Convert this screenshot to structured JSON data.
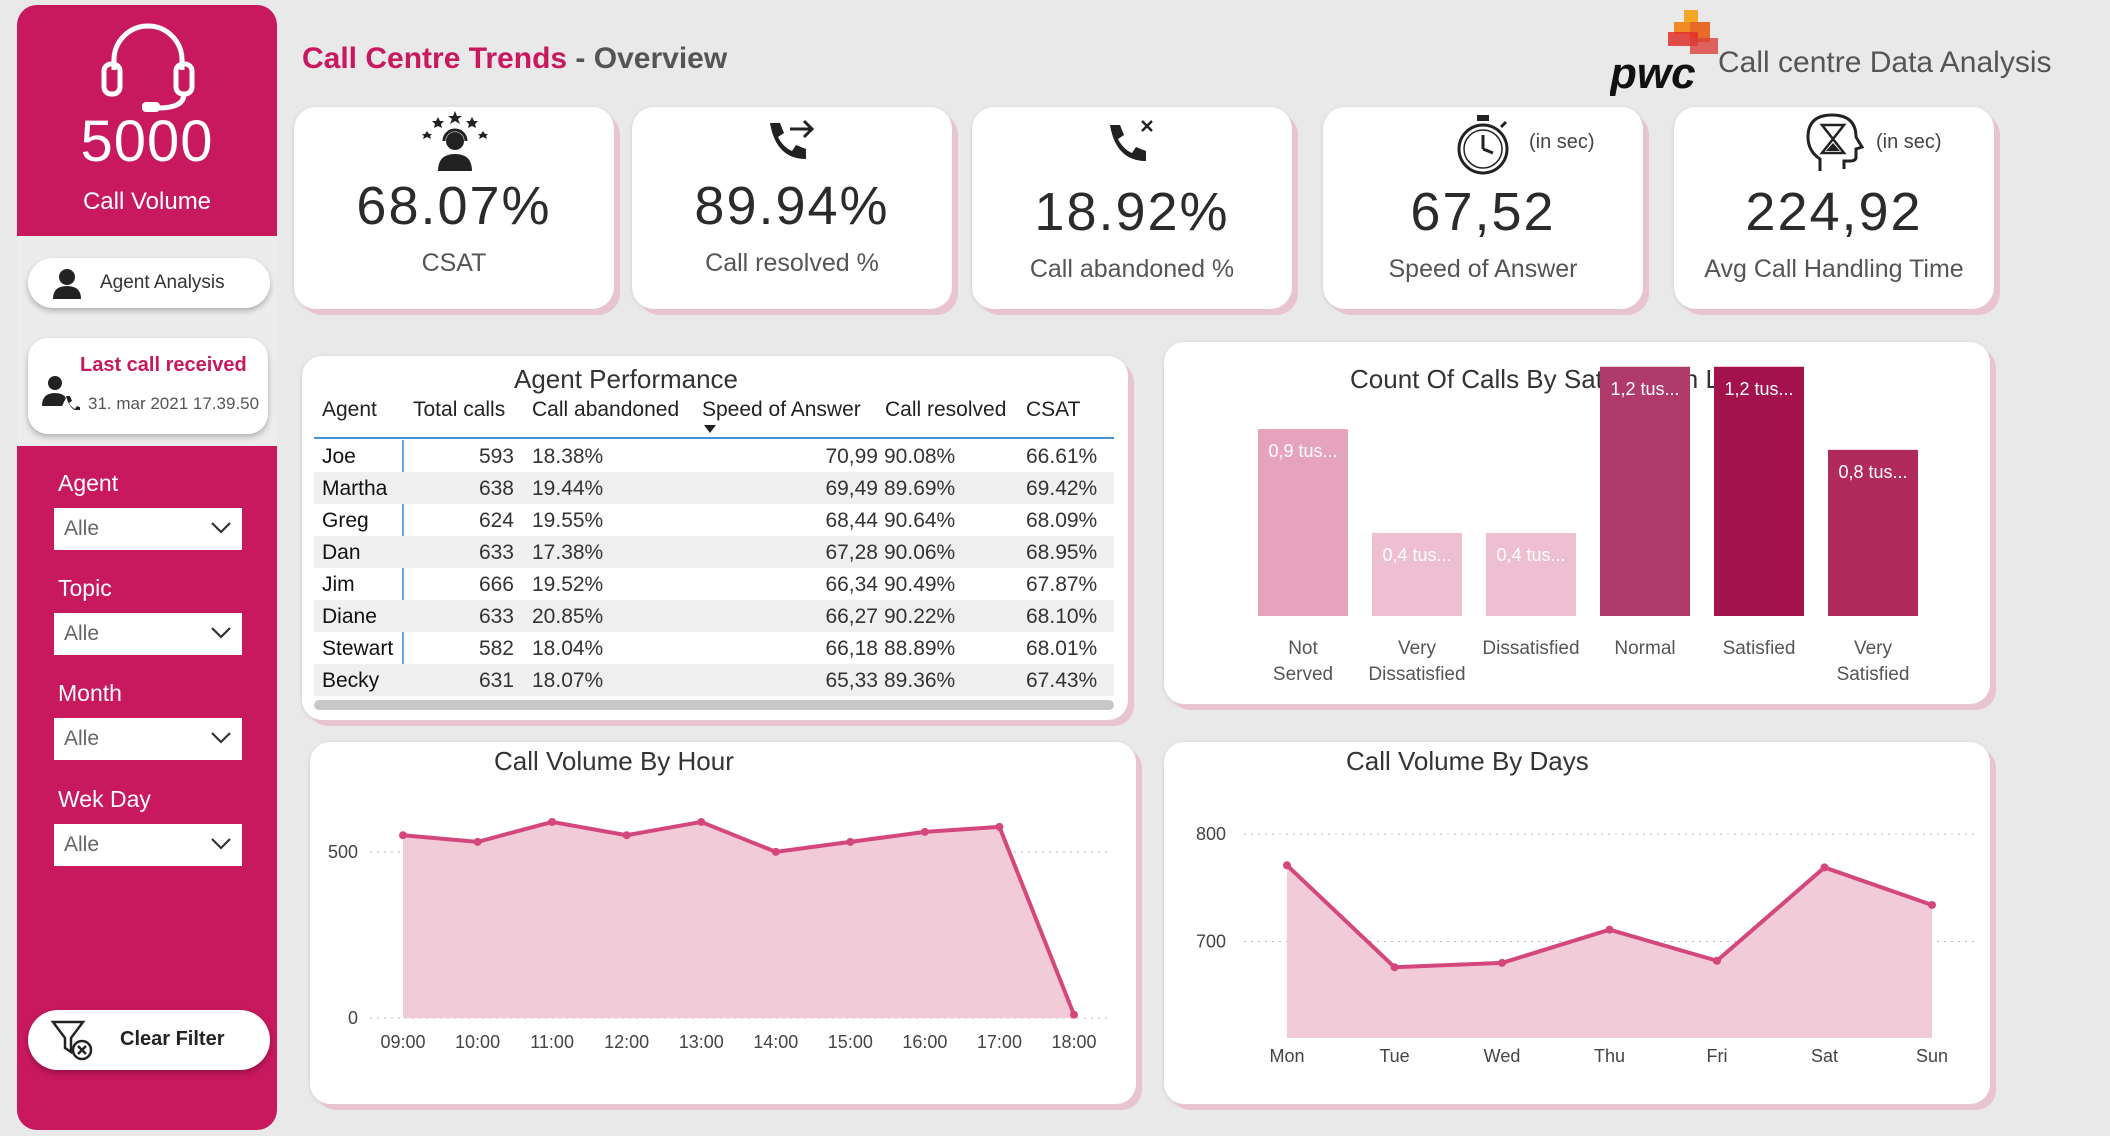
{
  "header": {
    "title_part1": "Call Centre Trends",
    "title_sep": " - ",
    "title_part2": "Overview",
    "brand": "pwc",
    "subtitle": "Call centre Data Analysis"
  },
  "sidebar": {
    "volume_value": "5000",
    "volume_label": "Call Volume",
    "agent_analysis_label": "Agent Analysis",
    "last_call_title": "Last call received",
    "last_call_value": "31. mar 2021 17.39.50",
    "filters": [
      {
        "label": "Agent",
        "value": "Alle"
      },
      {
        "label": "Topic",
        "value": "Alle"
      },
      {
        "label": "Month",
        "value": "Alle"
      },
      {
        "label": "Wek Day",
        "value": "Alle"
      }
    ],
    "clear_filter_label": "Clear Filter"
  },
  "kpis": [
    {
      "value": "68.07%",
      "label": "CSAT",
      "icon": "satisfaction-stars-icon"
    },
    {
      "value": "89.94%",
      "label": "Call resolved %",
      "icon": "phone-forward-icon"
    },
    {
      "value": "18.92%",
      "label": "Call abandoned %",
      "icon": "phone-missed-icon"
    },
    {
      "value": "67,52",
      "label": "Speed of Answer",
      "unit": "(in sec)",
      "icon": "stopwatch-icon"
    },
    {
      "value": "224,92",
      "label": "Avg Call Handling Time",
      "unit": "(in sec)",
      "icon": "head-hourglass-icon"
    }
  ],
  "agent_table": {
    "title": "Agent Performance",
    "columns": [
      "Agent",
      "Total calls",
      "Call abandoned",
      "Speed of Answer",
      "Call resolved",
      "CSAT"
    ],
    "rows": [
      [
        "Joe",
        "593",
        "18.38%",
        "70,99",
        "90.08%",
        "66.61%"
      ],
      [
        "Martha",
        "638",
        "19.44%",
        "69,49",
        "89.69%",
        "69.42%"
      ],
      [
        "Greg",
        "624",
        "19.55%",
        "68,44",
        "90.64%",
        "68.09%"
      ],
      [
        "Dan",
        "633",
        "17.38%",
        "67,28",
        "90.06%",
        "68.95%"
      ],
      [
        "Jim",
        "666",
        "19.52%",
        "66,34",
        "90.49%",
        "67.87%"
      ],
      [
        "Diane",
        "633",
        "20.85%",
        "66,27",
        "90.22%",
        "68.10%"
      ],
      [
        "Stewart",
        "582",
        "18.04%",
        "66,18",
        "88.89%",
        "68.01%"
      ],
      [
        "Becky",
        "631",
        "18.07%",
        "65,33",
        "89.36%",
        "67.43%"
      ]
    ]
  },
  "chart_data": [
    {
      "type": "bar",
      "title": "Count Of Calls By Satisfaction Level",
      "categories": [
        "Not Served",
        "Very Dissatisfied",
        "Dissatisfied",
        "Normal",
        "Satisfied",
        "Very Satisfied"
      ],
      "values": [
        900,
        400,
        400,
        1200,
        1200,
        800
      ],
      "data_labels": [
        "0,9 tus...",
        "0,4 tus...",
        "0,4 tus...",
        "1,2 tus...",
        "1,2 tus...",
        "0,8 tus..."
      ],
      "colors": [
        "#e6a3be",
        "#edbfd0",
        "#edbfd0",
        "#b03a6a",
        "#a3124c",
        "#b02a5c"
      ],
      "ylim": [
        0,
        1300
      ]
    },
    {
      "type": "area",
      "title": "Call Volume By Hour",
      "categories": [
        "09:00",
        "10:00",
        "11:00",
        "12:00",
        "13:00",
        "14:00",
        "15:00",
        "16:00",
        "17:00",
        "18:00"
      ],
      "values": [
        550,
        530,
        590,
        550,
        590,
        500,
        530,
        560,
        575,
        10
      ],
      "yticks": [
        0,
        500
      ],
      "ylim": [
        0,
        650
      ],
      "color": "#d4477d"
    },
    {
      "type": "area",
      "title": "Call Volume By Days",
      "categories": [
        "Mon",
        "Tue",
        "Wed",
        "Thu",
        "Fri",
        "Sat",
        "Sun"
      ],
      "values": [
        771,
        676,
        680,
        711,
        682,
        769,
        734
      ],
      "yticks": [
        700,
        800
      ],
      "ylim": [
        610,
        830
      ],
      "color": "#d4477d"
    }
  ],
  "colors": {
    "accent": "#c8185e",
    "area_fill": "#f2cbd9",
    "line": "#d4477d"
  }
}
